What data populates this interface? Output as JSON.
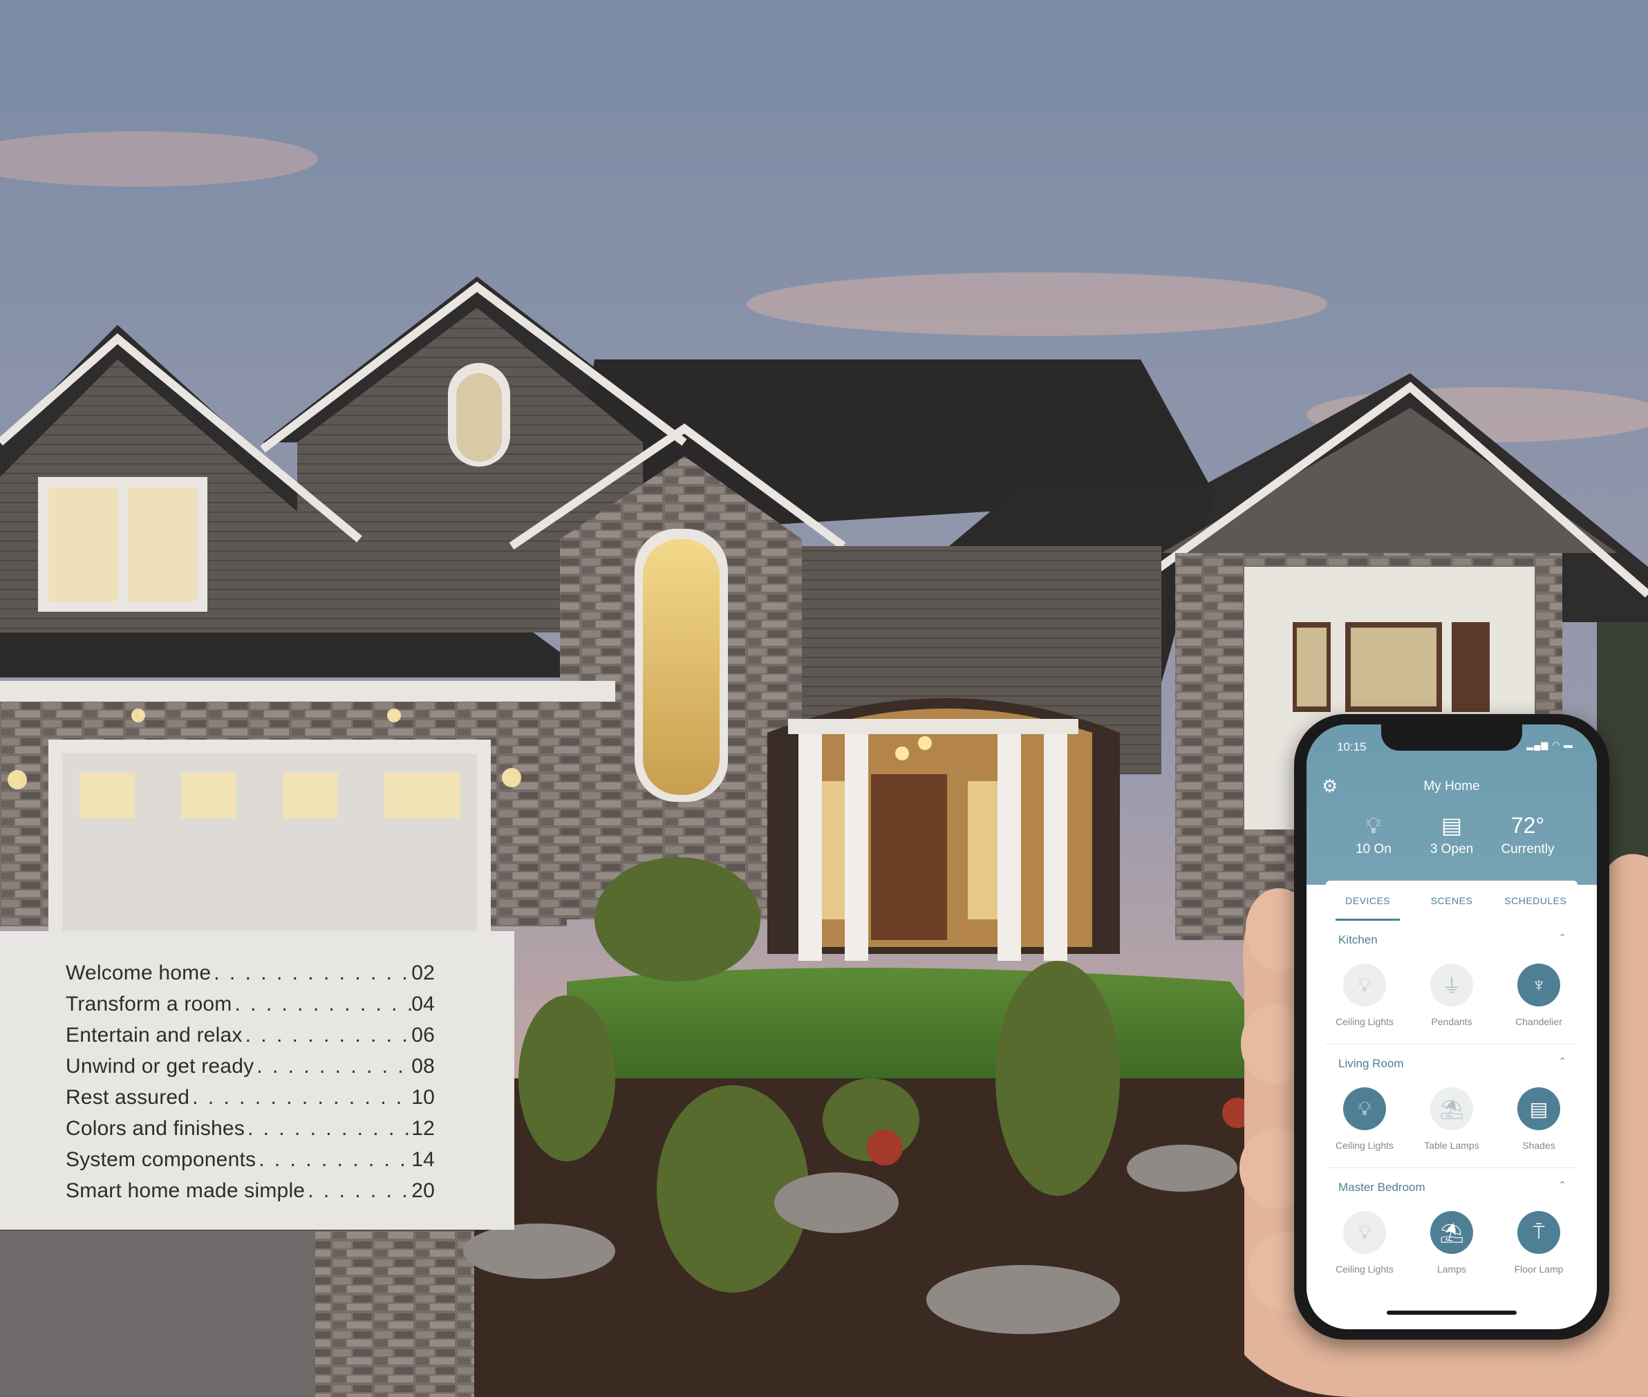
{
  "toc": [
    {
      "title": "Welcome home",
      "page": "02"
    },
    {
      "title": "Transform a room",
      "page": "04"
    },
    {
      "title": "Entertain and relax",
      "page": "06"
    },
    {
      "title": "Unwind or get ready",
      "page": "08"
    },
    {
      "title": "Rest assured",
      "page": "10"
    },
    {
      "title": "Colors and finishes",
      "page": "12"
    },
    {
      "title": "System components",
      "page": "14"
    },
    {
      "title": "Smart home made simple",
      "page": "20"
    }
  ],
  "phone": {
    "time": "10:15",
    "title": "My Home",
    "summary": [
      {
        "icon": "bulb-icon",
        "label": "10 On"
      },
      {
        "icon": "shade-icon",
        "label": "3 Open"
      },
      {
        "value": "72°",
        "label": "Currently"
      }
    ],
    "tabs": [
      "DEVICES",
      "SCENES",
      "SCHEDULES"
    ],
    "active_tab": "DEVICES",
    "rooms": [
      {
        "name": "Kitchen",
        "devices": [
          {
            "label": "Ceiling Lights",
            "icon": "bulb-icon",
            "state": "off"
          },
          {
            "label": "Pendants",
            "icon": "pendant-icon",
            "state": "off"
          },
          {
            "label": "Chandelier",
            "icon": "chandelier-icon",
            "state": "on"
          }
        ]
      },
      {
        "name": "Living Room",
        "devices": [
          {
            "label": "Ceiling Lights",
            "icon": "bulb-icon",
            "state": "on"
          },
          {
            "label": "Table Lamps",
            "icon": "table-lamp-icon",
            "state": "off"
          },
          {
            "label": "Shades",
            "icon": "shade-icon",
            "state": "on"
          }
        ]
      },
      {
        "name": "Master Bedroom",
        "devices": [
          {
            "label": "Ceiling Lights",
            "icon": "bulb-icon",
            "state": "off"
          },
          {
            "label": "Lamps",
            "icon": "lamp-icon",
            "state": "on"
          },
          {
            "label": "Floor Lamp",
            "icon": "floor-lamp-icon",
            "state": "on"
          }
        ]
      }
    ]
  },
  "colors": {
    "sky_top": "#7d8ea6",
    "siding": "#5b5651",
    "roof": "#2e2c2c",
    "stone": "#7b716d",
    "lawn": "#4e7d2e",
    "app_accent": "#4f7f94"
  }
}
